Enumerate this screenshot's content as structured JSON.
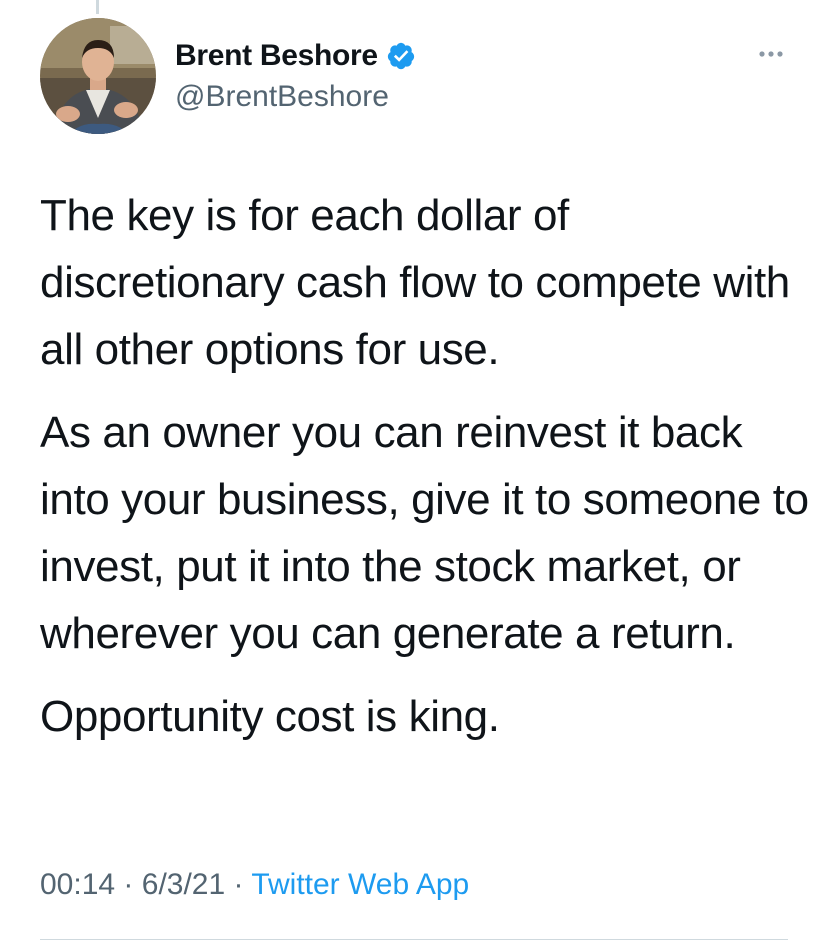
{
  "tweet": {
    "author": {
      "display_name": "Brent Beshore",
      "handle": "@BrentBeshore",
      "verified": true,
      "verified_icon": "verified-badge-icon",
      "avatar_icon": "profile-photo"
    },
    "more_icon": "more-options-icon",
    "paragraphs": [
      "The key is for each dollar of discretionary cash flow to compete with all other options for use.",
      "As an owner you can reinvest it back into your business, give it to someone to invest, put it into the stock market, or wherever you can generate a return.",
      "Opportunity cost is king."
    ],
    "time": "00:14",
    "date": "6/3/21",
    "separator": "·",
    "source": "Twitter Web App"
  },
  "colors": {
    "text_primary": "#0f1419",
    "text_secondary": "#536471",
    "accent": "#1d9bf0",
    "divider": "#cfd9de"
  }
}
